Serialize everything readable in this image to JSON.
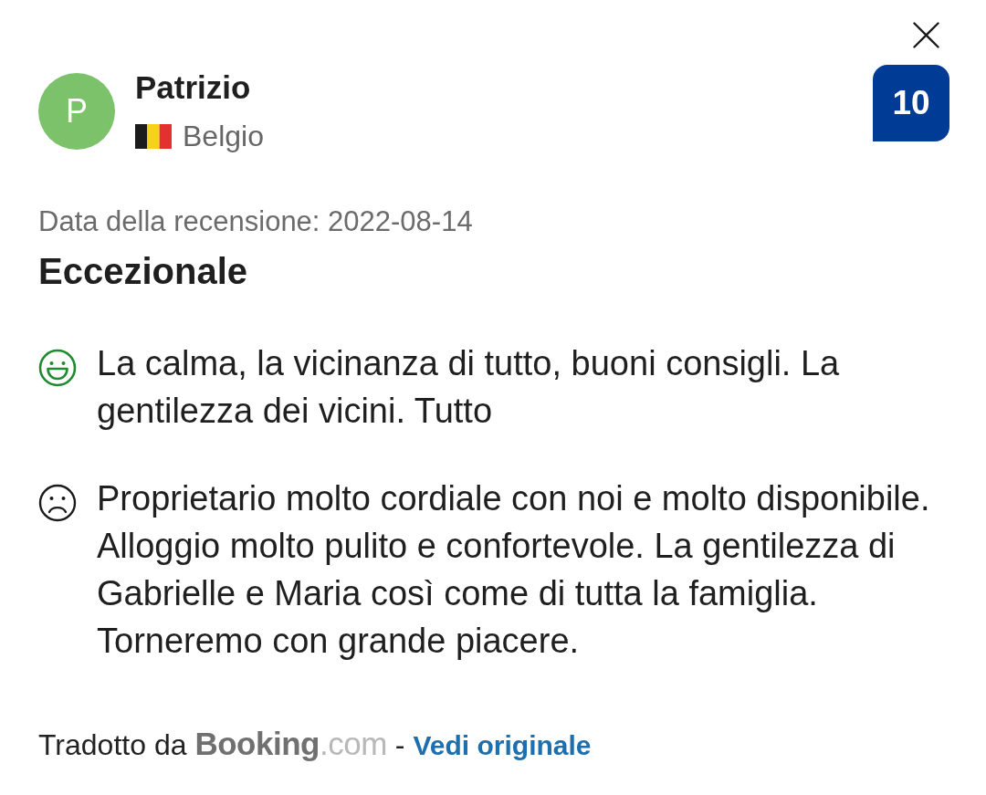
{
  "reviewer": {
    "initial": "P",
    "name": "Patrizio",
    "country": "Belgio"
  },
  "score": "10",
  "review": {
    "date": "Data della recensione: 2022-08-14",
    "title": "Eccezionale",
    "comments": [
      {
        "kind": "positive",
        "text": "La calma, la vicinanza di tutto, buoni consigli. La gentilezza dei vicini. Tutto"
      },
      {
        "kind": "negative",
        "text": "Proprietario molto cordiale con noi e molto disponibile. Alloggio molto pulito e confortevole. La gentilezza di Gabrielle e Maria così come di tutta la famiglia. Torneremo con grande piacere."
      }
    ]
  },
  "footer": {
    "translated_by": "Tradotto da",
    "brand": "Booking",
    "brand_suffix": ".com",
    "separator": "-",
    "link": "Vedi originale"
  }
}
